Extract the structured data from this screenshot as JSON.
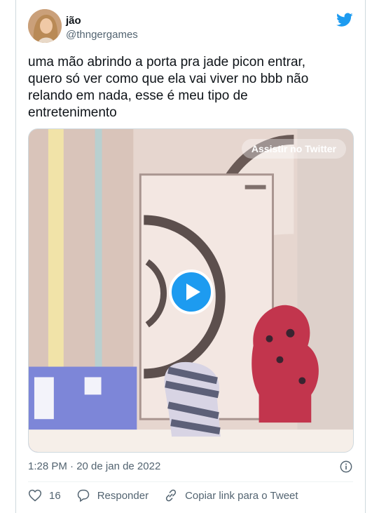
{
  "author": {
    "name": "jão",
    "handle": "@thngergames"
  },
  "tweet": {
    "text": "uma mão abrindo a porta pra jade picon entrar,\nquero só ver como que ela vai viver no bbb não\nrelando em nada, esse é meu tipo de\nentretenimento"
  },
  "media": {
    "watch_label": "Assistir no Twitter"
  },
  "meta": {
    "timestamp": "1:28 PM · 20 de jan de 2022"
  },
  "actions": {
    "likes": "16",
    "reply_label": "Responder",
    "copy_label": "Copiar link para o Tweet"
  },
  "colors": {
    "accent": "#1d9bf0",
    "secondary_text": "#536471"
  },
  "icons": [
    "twitter-bird-icon",
    "play-icon",
    "info-icon",
    "heart-icon",
    "reply-icon",
    "link-icon"
  ]
}
